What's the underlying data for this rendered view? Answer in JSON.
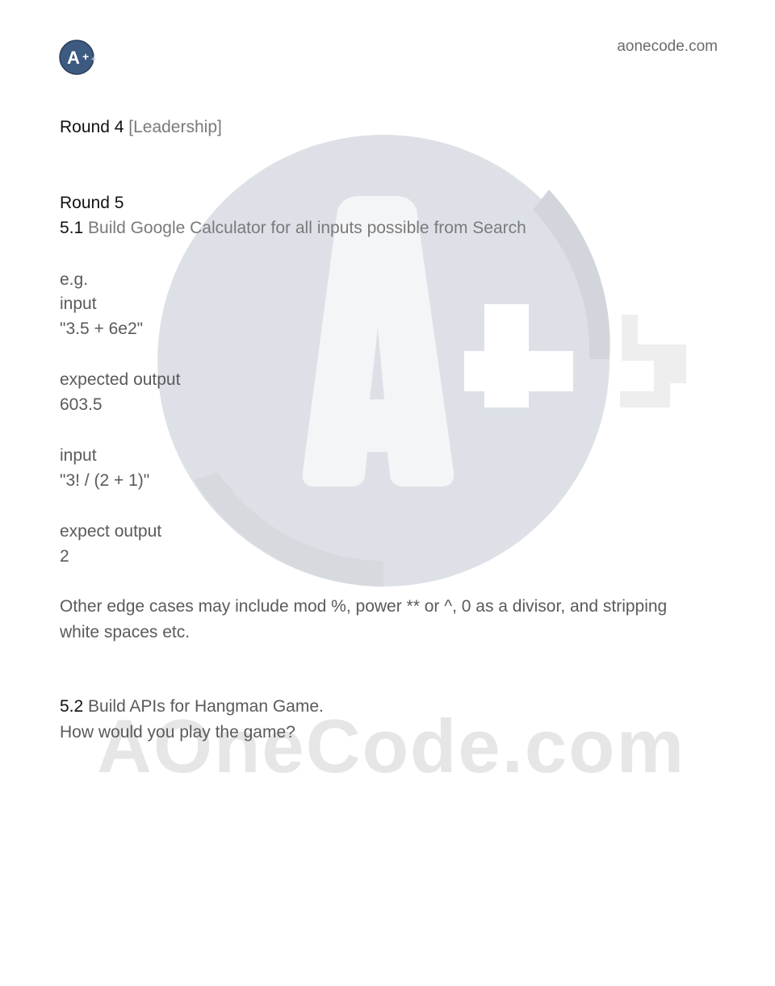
{
  "header": {
    "site_url": "aonecode.com",
    "logo_text": "A+",
    "logo_color": "#3d5a80"
  },
  "watermark": {
    "logo_text": "A+",
    "text": "AOneCode.com"
  },
  "round4": {
    "label": "Round 4",
    "category": "[Leadership]"
  },
  "round5": {
    "label": "Round 5",
    "q1_number": "5.1",
    "q1_title": "Build Google Calculator for all inputs possible from Search",
    "eg": "e.g.",
    "input_label_1": "input",
    "input_value_1": "\"3.5 + 6e2\"",
    "output_label_1": "expected output",
    "output_value_1": "603.5",
    "input_label_2": "input",
    "input_value_2": "\"3! / (2 + 1)\"",
    "output_label_2": "expect output",
    "output_value_2": "2",
    "edge_cases": "Other edge cases may include mod %, power ** or ^,  0 as a divisor, and stripping white spaces etc.",
    "q2_number": "5.2",
    "q2_title": "Build APIs for Hangman Game.",
    "q2_sub": "How would you play the game?"
  }
}
